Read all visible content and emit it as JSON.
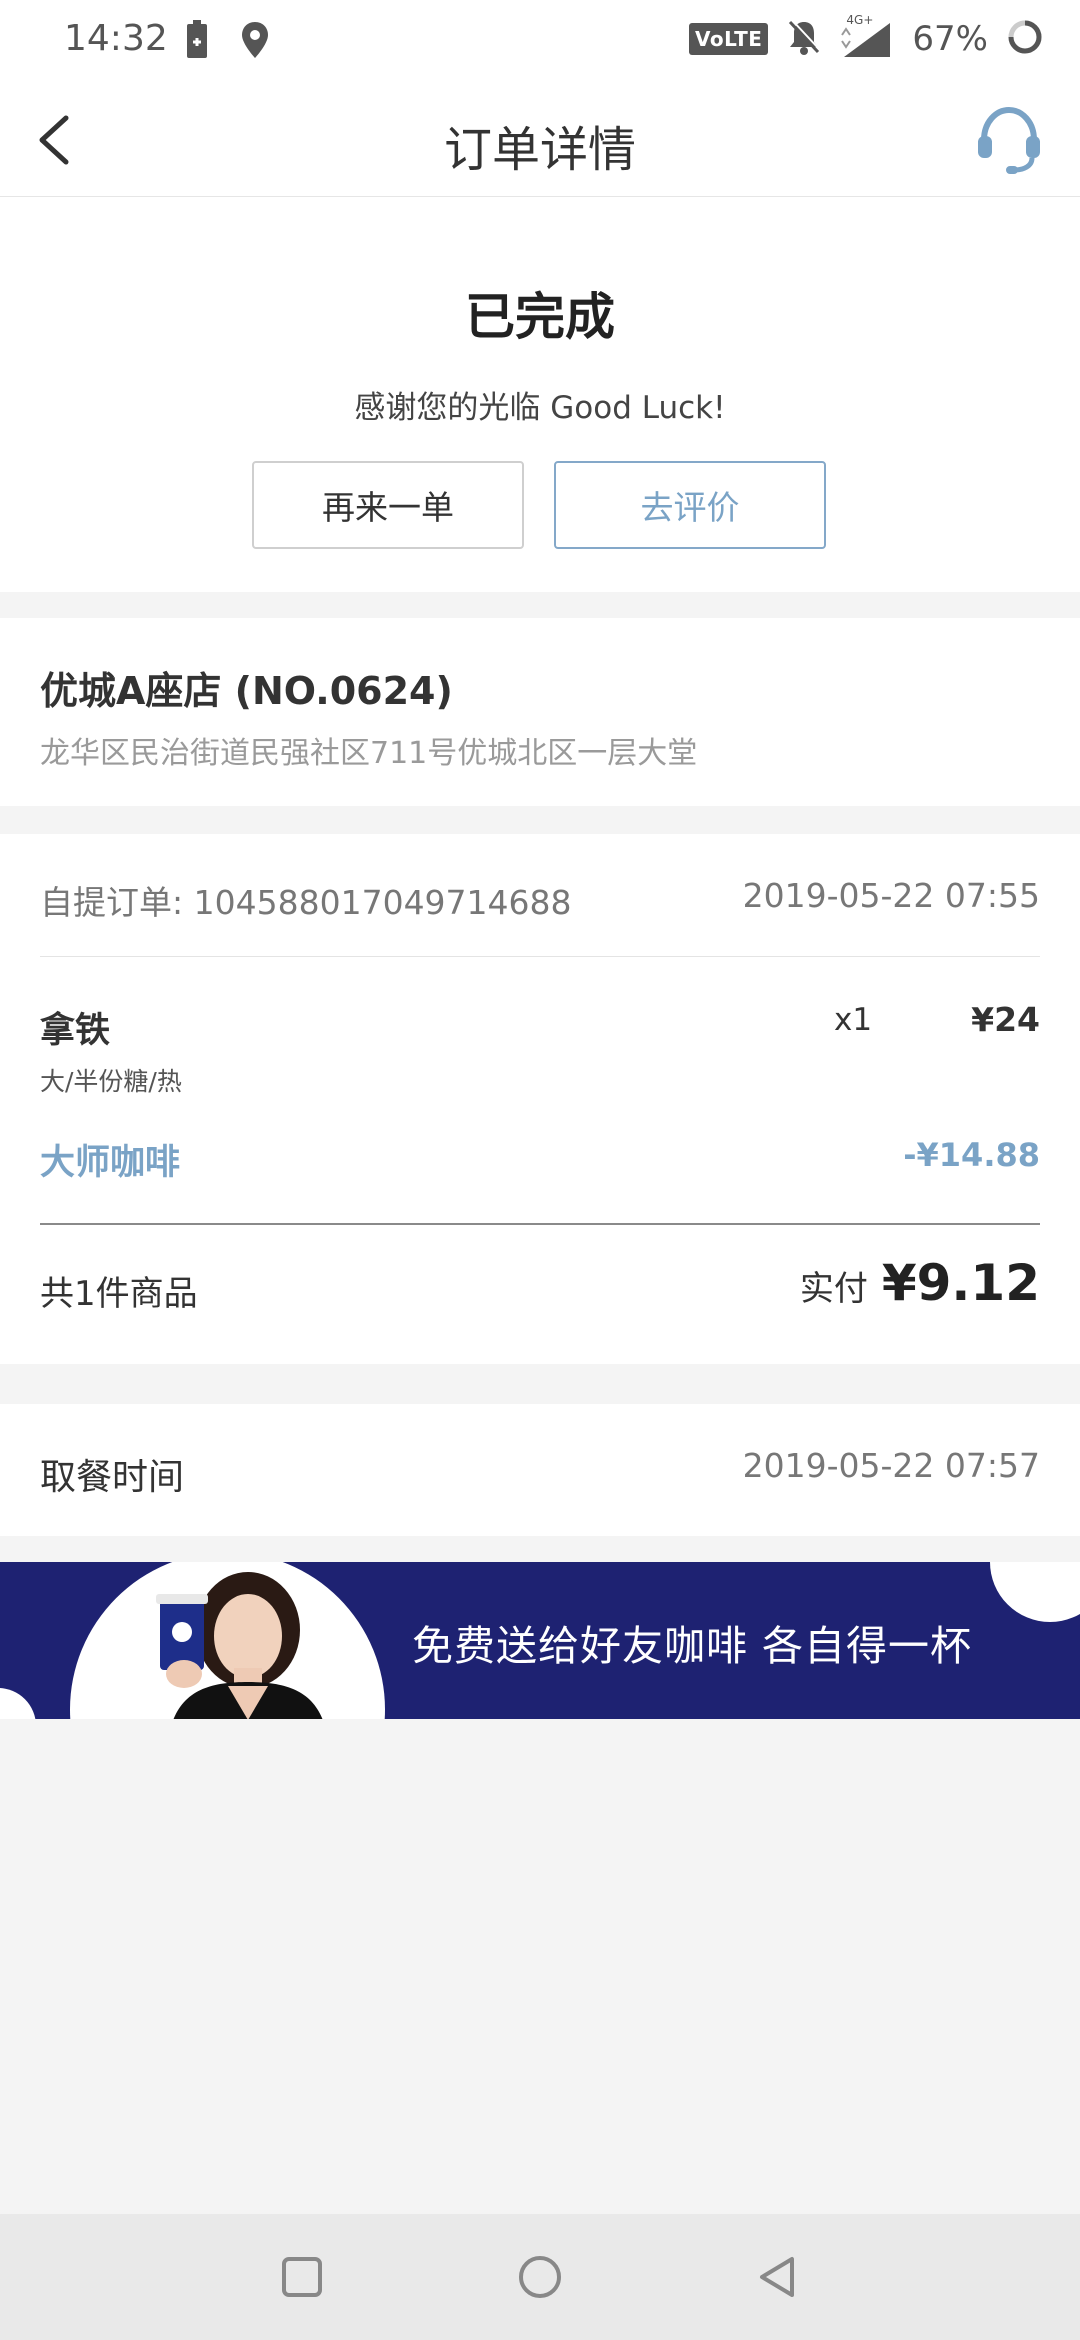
{
  "status_bar": {
    "time": "14:32",
    "network_badge": "VoLTE",
    "signal_label": "4G+",
    "battery_percent": "67%",
    "icons": [
      "battery-charging-icon",
      "location-icon",
      "volte-icon",
      "mute-icon",
      "signal-icon",
      "loading-icon"
    ]
  },
  "header": {
    "title": "订单详情",
    "back_icon": "chevron-left-icon",
    "service_icon": "headset-icon"
  },
  "status": {
    "title": "已完成",
    "subtitle": "感谢您的光临 Good Luck!",
    "reorder_label": "再来一单",
    "review_label": "去评价"
  },
  "store": {
    "name": "优城A座店 (NO.0624)",
    "address": "龙华区民治街道民强社区711号优城北区一层大堂"
  },
  "order": {
    "number_label": "自提订单: 104588017049714688",
    "order_time": "2019-05-22 07:55",
    "items": [
      {
        "name": "拿铁",
        "options": "大/半份糖/热",
        "quantity": "x1",
        "price": "¥24"
      }
    ],
    "discount": {
      "name": "大师咖啡",
      "amount": "-¥14.88"
    },
    "total_count": "共1件商品",
    "total_label": "实付",
    "total_value": "¥9.12"
  },
  "pickup": {
    "label": "取餐时间",
    "time": "2019-05-22 07:57"
  },
  "banner": {
    "text": "免费送给好友咖啡 各自得一杯"
  },
  "colors": {
    "accent": "#7aa3c6",
    "banner_bg": "#1e2272",
    "page_bg": "#f4f4f4"
  }
}
